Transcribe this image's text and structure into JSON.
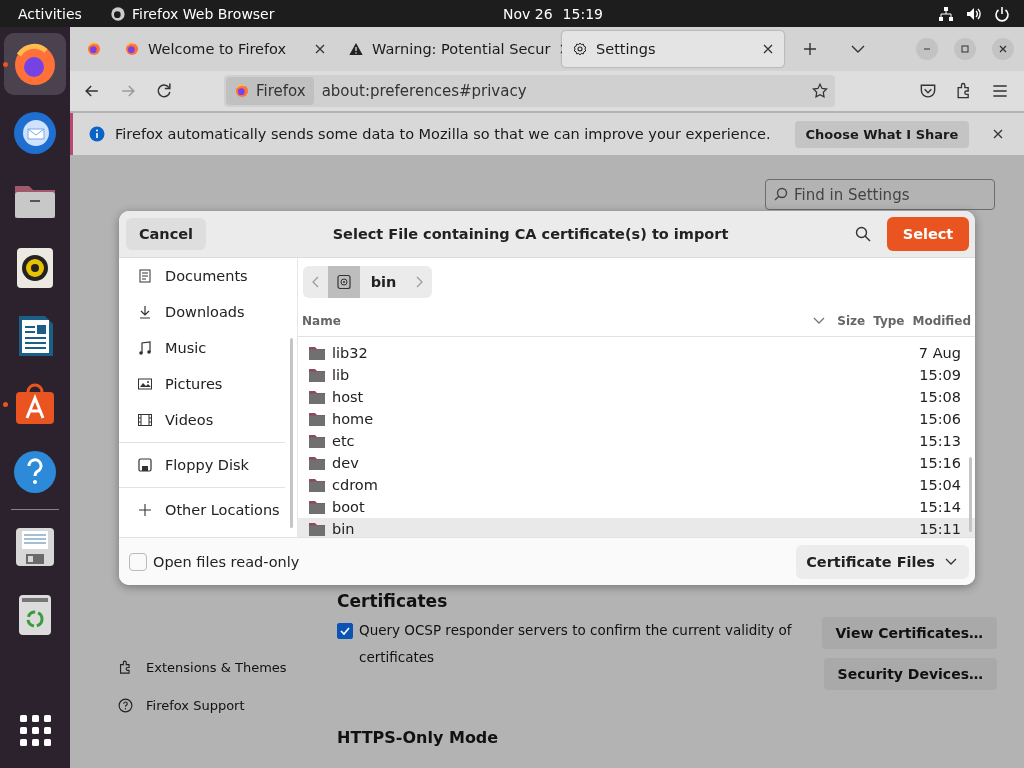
{
  "top_bar": {
    "activities": "Activities",
    "app_name": "Firefox Web Browser",
    "date": "Nov 26",
    "time": "15:19"
  },
  "dock": {
    "favorites": [
      {
        "kind": "firefox",
        "running": true,
        "selected": true
      },
      {
        "kind": "thunderbird",
        "running": false,
        "selected": false
      },
      {
        "kind": "files",
        "running": false,
        "selected": false
      },
      {
        "kind": "rhythmbox",
        "running": false,
        "selected": false
      },
      {
        "kind": "writer",
        "running": false,
        "selected": false
      },
      {
        "kind": "appcenter",
        "running": true,
        "selected": false
      },
      {
        "kind": "help",
        "running": false,
        "selected": false
      }
    ],
    "mounted": [
      {
        "kind": "floppy",
        "running": false,
        "selected": false
      },
      {
        "kind": "trash",
        "running": false,
        "selected": false
      }
    ]
  },
  "tabs": [
    {
      "kind": "pinned",
      "selected": false
    },
    {
      "kind": "firefox",
      "label": "Welcome to Firefox",
      "selected": false
    },
    {
      "kind": "warning",
      "label": "Warning: Potential Secur",
      "selected": false
    },
    {
      "kind": "settings",
      "label": "Settings",
      "selected": true
    }
  ],
  "nav_buttons": [
    {
      "kind": "back",
      "disabled": false
    },
    {
      "kind": "forward",
      "disabled": true
    },
    {
      "kind": "reload",
      "disabled": false
    }
  ],
  "url_bar": {
    "identity": "Firefox",
    "value": "about:preferences#privacy"
  },
  "notification": {
    "message": "Firefox automatically sends some data to Mozilla so that we can improve your experience.",
    "button": "Choose What I Share"
  },
  "settings": {
    "search_placeholder": "Find in Settings",
    "sidebar_links": [
      {
        "kind": "extensions",
        "label": "Extensions & Themes"
      },
      {
        "kind": "support",
        "label": "Firefox Support"
      }
    ],
    "certificates_heading": "Certificates",
    "ocsp": {
      "label": "Query OCSP responder servers to confirm the current validity of certificates",
      "checked": true
    },
    "certificate_buttons": [
      "View Certificates…",
      "Security Devices…"
    ],
    "https_heading": "HTTPS-Only Mode"
  },
  "dialog": {
    "title": "Select File containing CA certificate(s) to import",
    "cancel": "Cancel",
    "select": "Select",
    "places": [
      [
        {
          "kind": "documents",
          "label": "Documents"
        },
        {
          "kind": "downloads",
          "label": "Downloads"
        },
        {
          "kind": "music",
          "label": "Music"
        },
        {
          "kind": "pictures",
          "label": "Pictures"
        },
        {
          "kind": "videos",
          "label": "Videos"
        }
      ],
      [
        {
          "kind": "floppy",
          "label": "Floppy Disk"
        }
      ],
      [
        {
          "kind": "other",
          "label": "Other Locations"
        }
      ]
    ],
    "path": "bin",
    "columns": [
      "Name",
      "Size",
      "Type",
      "Modified"
    ],
    "files": [
      {
        "name": "lib32",
        "modified": "7 Aug",
        "selected": false
      },
      {
        "name": "lib",
        "modified": "15:09",
        "selected": false
      },
      {
        "name": "host",
        "modified": "15:08",
        "selected": false
      },
      {
        "name": "home",
        "modified": "15:06",
        "selected": false
      },
      {
        "name": "etc",
        "modified": "15:13",
        "selected": false
      },
      {
        "name": "dev",
        "modified": "15:16",
        "selected": false
      },
      {
        "name": "cdrom",
        "modified": "15:04",
        "selected": false
      },
      {
        "name": "boot",
        "modified": "15:14",
        "selected": false
      },
      {
        "name": "bin",
        "modified": "15:11",
        "selected": true
      }
    ],
    "read_only": {
      "label": "Open files read-only",
      "checked": false
    },
    "filter": "Certificate Files"
  }
}
